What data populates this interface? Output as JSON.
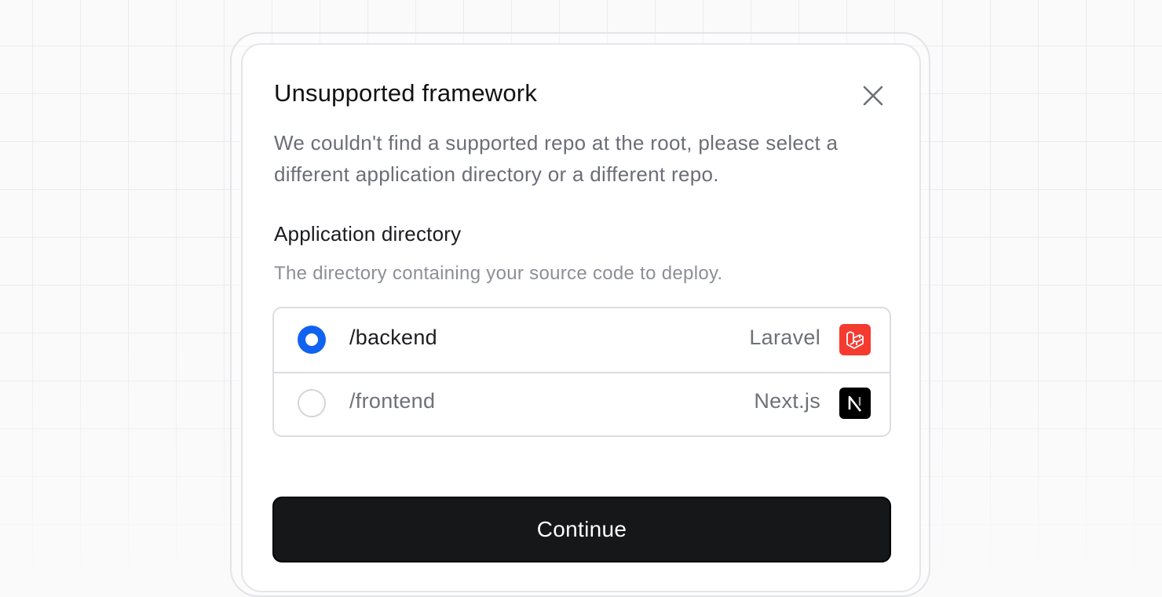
{
  "dialog": {
    "title": "Unsupported framework",
    "description": "We couldn't find a supported repo at the root, please select a different application directory or a different repo.",
    "close_icon": "close-icon"
  },
  "directory": {
    "label": "Application directory",
    "help": "The directory containing your source code to deploy.",
    "options": [
      {
        "path": "/backend",
        "framework": "Laravel",
        "icon": "laravel-icon",
        "selected": true,
        "icon_color": "#f53a2f"
      },
      {
        "path": "/frontend",
        "framework": "Next.js",
        "icon": "nextjs-icon",
        "selected": false,
        "icon_color": "#000000"
      }
    ]
  },
  "actions": {
    "continue_label": "Continue"
  },
  "colors": {
    "accent": "#1063f0",
    "button_bg": "#161718"
  }
}
